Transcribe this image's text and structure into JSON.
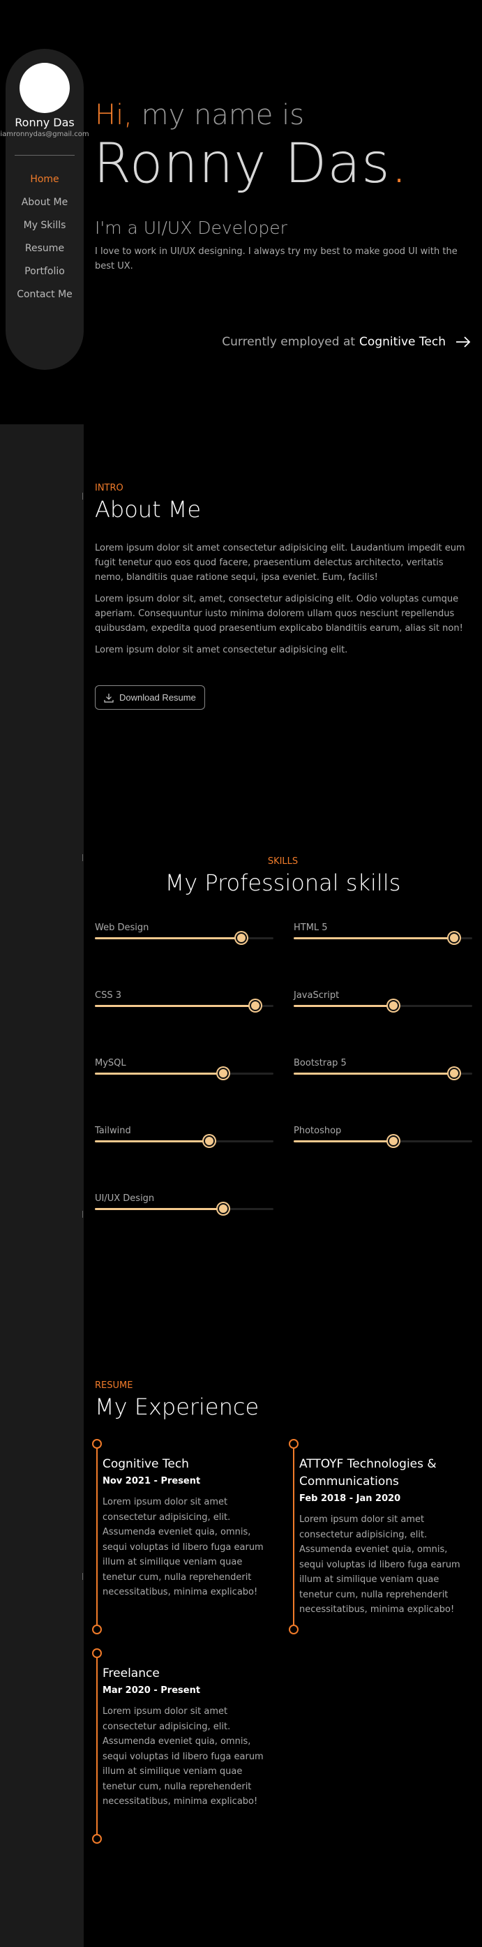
{
  "sidebar": {
    "name": "Ronny Das",
    "email": "iamronnydas@gmail.com",
    "nav": [
      "Home",
      "About Me",
      "My Skills",
      "Resume",
      "Portfolio",
      "Contact Me"
    ]
  },
  "hero": {
    "hi": "Hi,",
    "intro": " my name is",
    "name": "Ronny Das",
    "dot": ".",
    "role": "I'm a UI/UX Developer",
    "description": "I love to work in UI/UX designing. I always try my best to make good UI with the best UX.",
    "employed_prefix": "Currently employed at",
    "company": "Cognitive Tech"
  },
  "about": {
    "eyebrow": "INTRO",
    "title": "About Me",
    "paragraphs": [
      "Lorem ipsum dolor sit amet consectetur adipisicing elit. Laudantium impedit eum fugit tenetur quo eos quod facere, praesentium delectus architecto, veritatis nemo, blanditiis quae ratione sequi, ipsa eveniet. Eum, facilis!",
      "Lorem ipsum dolor sit, amet, consectetur adipisicing elit. Odio voluptas cumque aperiam. Consequuntur iusto minima dolorem ullam quos nesciunt repellendus quibusdam, expedita quod praesentium explicabo blanditiis earum, alias sit non!",
      "Lorem ipsum dolor sit amet consectetur adipisicing elit."
    ],
    "download_label": "Download Resume"
  },
  "skills": {
    "eyebrow": "SKILLS",
    "title": "My Professional skills",
    "items": [
      {
        "label": "Web Design",
        "level": 0.82
      },
      {
        "label": "HTML 5",
        "level": 0.9
      },
      {
        "label": "CSS 3",
        "level": 0.9
      },
      {
        "label": "JavaScript",
        "level": 0.56
      },
      {
        "label": "MySQL",
        "level": 0.72
      },
      {
        "label": "Bootstrap 5",
        "level": 0.9
      },
      {
        "label": "Tailwind",
        "level": 0.64
      },
      {
        "label": "Photoshop",
        "level": 0.56
      },
      {
        "label": "UI/UX Design",
        "level": 0.72
      }
    ]
  },
  "resume": {
    "eyebrow": "RESUME",
    "title": "My Experience",
    "items": [
      {
        "title": "Cognitive Tech",
        "date": "Nov 2021 - Present",
        "text": "Lorem ipsum dolor sit amet consectetur adipisicing, elit. Assumenda eveniet quia, omnis, sequi voluptas id libero fuga earum illum at similique veniam quae tenetur cum, nulla reprehenderit necessitatibus, minima explicabo!"
      },
      {
        "title": "ATTOYF Technologies & Communications",
        "date": "Feb 2018 - Jan 2020",
        "text": "Lorem ipsum dolor sit amet consectetur adipisicing, elit. Assumenda eveniet quia, omnis, sequi voluptas id libero fuga earum illum at similique veniam quae tenetur cum, nulla reprehenderit necessitatibus, minima explicabo!"
      },
      {
        "title": "Freelance",
        "date": "Mar 2020 - Present",
        "text": "Lorem ipsum dolor sit amet consectetur adipisicing, elit. Assumenda eveniet quia, omnis, sequi voluptas id libero fuga earum illum at similique veniam quae tenetur cum, nulla reprehenderit necessitatibus, minima explicabo!"
      }
    ]
  },
  "colors": {
    "accent": "#f07b2a",
    "skill_bar": "#f4c98e",
    "background": "#000000",
    "sidebar": "#1e1e1e"
  },
  "icons": {
    "download": "download-icon",
    "arrow": "arrow-right-icon"
  }
}
